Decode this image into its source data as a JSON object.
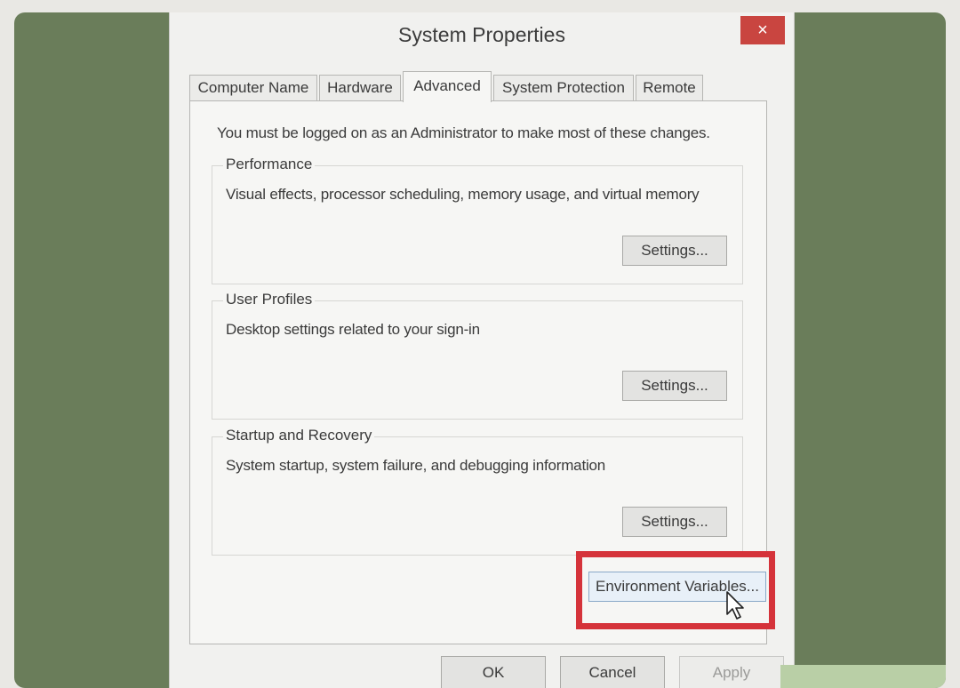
{
  "dialog": {
    "title": "System Properties",
    "close_label": "×",
    "tabs": [
      {
        "label": "Computer Name"
      },
      {
        "label": "Hardware"
      },
      {
        "label": "Advanced"
      },
      {
        "label": "System Protection"
      },
      {
        "label": "Remote"
      }
    ],
    "admin_note": "You must be logged on as an Administrator to make most of these changes.",
    "groups": [
      {
        "title": "Performance",
        "description": "Visual effects, processor scheduling, memory usage, and virtual memory",
        "button": "Settings..."
      },
      {
        "title": "User Profiles",
        "description": "Desktop settings related to your sign-in",
        "button": "Settings..."
      },
      {
        "title": "Startup and Recovery",
        "description": "System startup, system failure, and debugging information",
        "button": "Settings..."
      }
    ],
    "env_button": "Environment Variables...",
    "buttons": {
      "ok": "OK",
      "cancel": "Cancel",
      "apply": "Apply"
    }
  },
  "colors": {
    "background": "#6a7d5a",
    "highlight": "#d5333a",
    "close": "#c94540"
  }
}
